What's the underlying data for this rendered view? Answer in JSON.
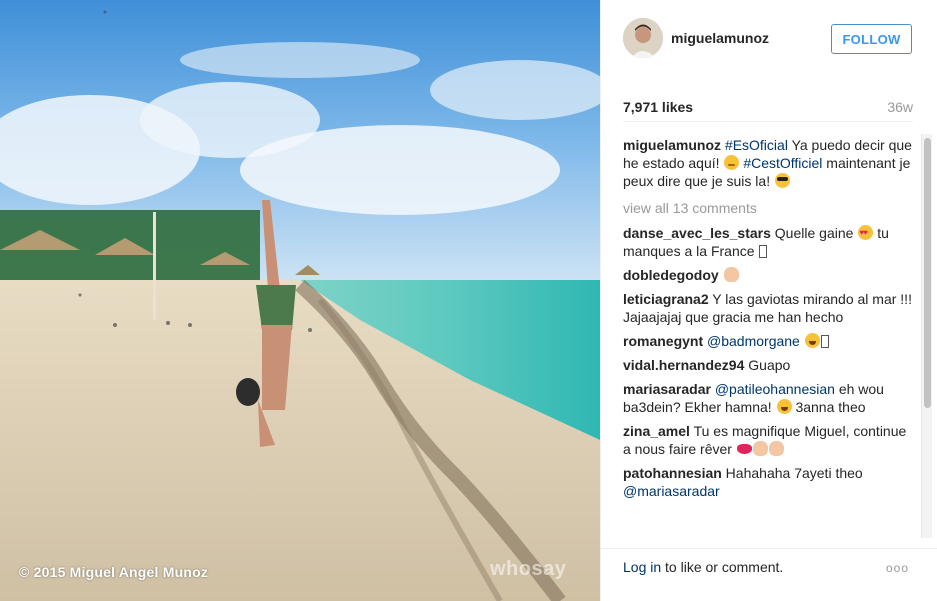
{
  "photo": {
    "credit": "© 2015 Miguel Angel Munoz",
    "watermark": "whosay"
  },
  "header": {
    "username": "miguelamunoz",
    "follow_label": "FOLLOW"
  },
  "stats": {
    "likes": "7,971 likes",
    "age": "36w"
  },
  "caption": {
    "user": "miguelamunoz",
    "hashtag1": "#EsOficial",
    "text1": " Ya puedo decir que he estado aquí! ",
    "hashtag2": "#CestOfficiel",
    "text2": " maintenant je peux dire que je suis la! "
  },
  "view_all": "view all 13 comments",
  "comments": [
    {
      "user": "danse_avec_les_stars",
      "text": " Quelle gaine ",
      "text_after": " tu manques a la France "
    },
    {
      "user": "dobledegodoy",
      "text": " "
    },
    {
      "user": "leticiagrana2",
      "text": " Y las gaviotas mirando al mar !!! Jajaajajaj que gracia me han hecho"
    },
    {
      "user": "romanegynt",
      "mention": "@badmorgane",
      "text": " "
    },
    {
      "user": "vidal.hernandez94",
      "text": " Guapo"
    },
    {
      "user": "mariasaradar",
      "mention": "@patileohannesian",
      "text": " eh wou ba3dein? Ekher hamna! ",
      "text_after": " 3anna theo"
    },
    {
      "user": "zina_amel",
      "text": " Tu es magnifique Miguel, continue a nous faire rêver "
    },
    {
      "user": "patohannesian",
      "text": " Hahahaha 7ayeti theo ",
      "mention_after": "@mariasaradar"
    }
  ],
  "footer": {
    "login_link": "Log in",
    "login_text": " to like or comment.",
    "more_icon": "ooo"
  },
  "colors": {
    "link": "#003569",
    "follow": "#3897f0",
    "muted": "#999999"
  }
}
